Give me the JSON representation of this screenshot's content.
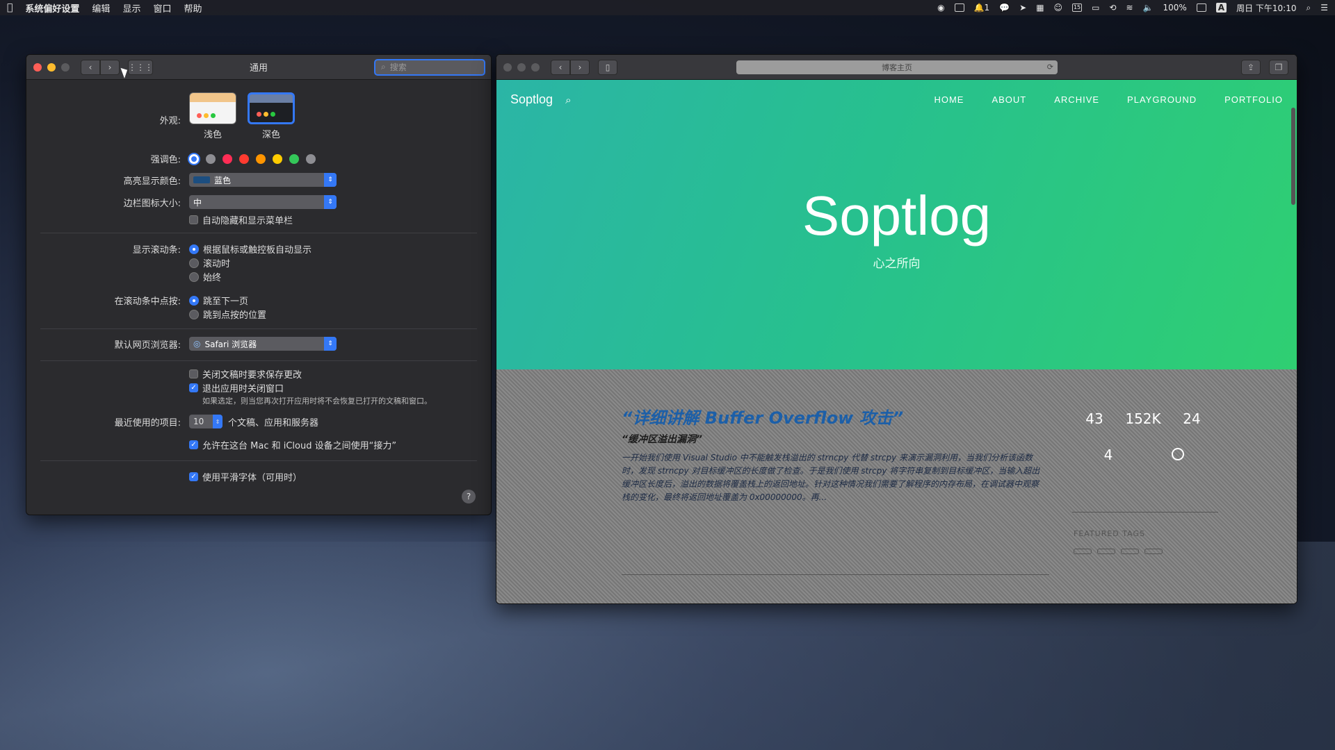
{
  "menubar": {
    "app_name": "系统偏好设置",
    "items": [
      "编辑",
      "显示",
      "窗口",
      "帮助"
    ],
    "battery": "100%",
    "input_method": "A",
    "datetime": "周日 下午10:10",
    "badge_count": "1",
    "calendar_day": "15"
  },
  "prefs": {
    "title": "通用",
    "search_placeholder": "搜索",
    "appearance_label": "外观:",
    "appearance_options": [
      "浅色",
      "深色"
    ],
    "accent_label": "强调色:",
    "accent_colors": [
      "#3478f6",
      "#8e8e93",
      "#ff2d55",
      "#ff3b30",
      "#ff9500",
      "#ffcc00",
      "#34c759",
      "#8e8e93"
    ],
    "highlight_label": "高亮显示颜色:",
    "highlight_value": "蓝色",
    "sidebar_icon_label": "边栏图标大小:",
    "sidebar_icon_value": "中",
    "auto_hide_menubar": "自动隐藏和显示菜单栏",
    "scroll_label": "显示滚动条:",
    "scroll_options": [
      "根据鼠标或触控板自动显示",
      "滚动时",
      "始终"
    ],
    "click_label": "在滚动条中点按:",
    "click_options": [
      "跳至下一页",
      "跳到点按的位置"
    ],
    "browser_label": "默认网页浏览器:",
    "browser_value": "Safari 浏览器",
    "ask_save": "关闭文稿时要求保存更改",
    "close_windows": "退出应用时关闭窗口",
    "close_windows_note": "如果选定，则当您再次打开应用时将不会恢复已打开的文稿和窗口。",
    "recent_label": "最近使用的项目:",
    "recent_value": "10",
    "recent_suffix": "个文稿、应用和服务器",
    "handoff": "允许在这台 Mac 和 iCloud 设备之间使用“接力”",
    "smooth_font": "使用平滑字体（可用时）",
    "help": "?"
  },
  "safari": {
    "url": "博客主页",
    "site": {
      "brand": "Soptlog",
      "nav": [
        "HOME",
        "ABOUT",
        "ARCHIVE",
        "PLAYGROUND",
        "PORTFOLIO"
      ],
      "hero_title": "Soptlog",
      "hero_subtitle": "心之所向"
    },
    "post": {
      "title": "“详细讲解 Buffer Overflow 攻击”",
      "subtitle": "“缓冲区溢出漏洞”",
      "excerpt": "一开始我们使用 Visual Studio 中不能触发栈溢出的 strncpy 代替 strcpy 来演示漏洞利用，当我们分析该函数时，发现 strncpy 对目标缓冲区的长度做了检查。于是我们使用 strcpy 将字符串复制到目标缓冲区，当输入超出缓冲区长度后，溢出的数据将覆盖栈上的返回地址。针对这种情况我们需要了解程序的内存布局，在调试器中观察栈的变化，最终将返回地址覆盖为 0x00000000。再...",
      "meta": "",
      "next_title": ""
    },
    "stats": {
      "items": [
        {
          "label": "",
          "value": "43"
        },
        {
          "label": "",
          "value": "152K"
        },
        {
          "label": "",
          "value": "24"
        }
      ],
      "row2": [
        {
          "label": "",
          "value": "4"
        },
        {
          "label": "",
          "value": ""
        }
      ]
    },
    "featured_label": "FEATURED TAGS",
    "tags": [
      "",
      "",
      "",
      ""
    ]
  }
}
